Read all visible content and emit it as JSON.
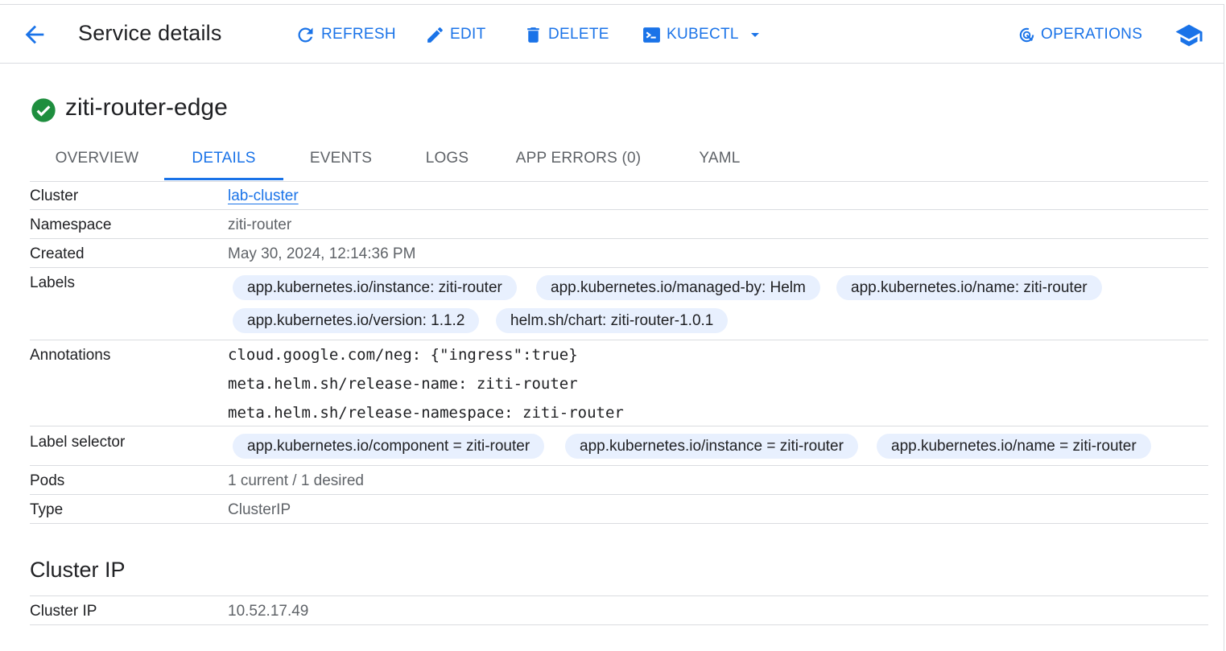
{
  "header": {
    "title": "Service details",
    "actions": {
      "refresh": "REFRESH",
      "edit": "EDIT",
      "delete": "DELETE",
      "kubectl": "KUBECTL",
      "operations": "OPERATIONS"
    }
  },
  "service": {
    "name": "ziti-router-edge",
    "status_color": "#1e8e3e"
  },
  "tabs": [
    {
      "label": "OVERVIEW"
    },
    {
      "label": "DETAILS",
      "active": true
    },
    {
      "label": "EVENTS"
    },
    {
      "label": "LOGS"
    },
    {
      "label": "APP ERRORS (0)"
    },
    {
      "label": "YAML"
    }
  ],
  "details": {
    "cluster": {
      "key": "Cluster",
      "value": "lab-cluster"
    },
    "namespace": {
      "key": "Namespace",
      "value": "ziti-router"
    },
    "created": {
      "key": "Created",
      "value": "May 30, 2024, 12:14:36 PM"
    },
    "labels": {
      "key": "Labels",
      "chips": [
        "app.kubernetes.io/instance: ziti-router",
        "app.kubernetes.io/managed-by: Helm",
        "app.kubernetes.io/name: ziti-router",
        "app.kubernetes.io/version: 1.1.2",
        "helm.sh/chart: ziti-router-1.0.1"
      ]
    },
    "annotations": {
      "key": "Annotations",
      "lines": [
        "cloud.google.com/neg: {\"ingress\":true}",
        "meta.helm.sh/release-name: ziti-router",
        "meta.helm.sh/release-namespace: ziti-router"
      ]
    },
    "label_selector": {
      "key": "Label selector",
      "chips": [
        "app.kubernetes.io/component = ziti-router",
        "app.kubernetes.io/instance = ziti-router",
        "app.kubernetes.io/name = ziti-router"
      ]
    },
    "pods": {
      "key": "Pods",
      "value": "1 current / 1 desired"
    },
    "type": {
      "key": "Type",
      "value": "ClusterIP"
    }
  },
  "cluster_ip_section": {
    "title": "Cluster IP",
    "row": {
      "key": "Cluster IP",
      "value": "10.52.17.49"
    }
  },
  "colors": {
    "accent": "#1a73e8",
    "chip_bg": "#e8f0fe",
    "divider": "#dadce0"
  }
}
